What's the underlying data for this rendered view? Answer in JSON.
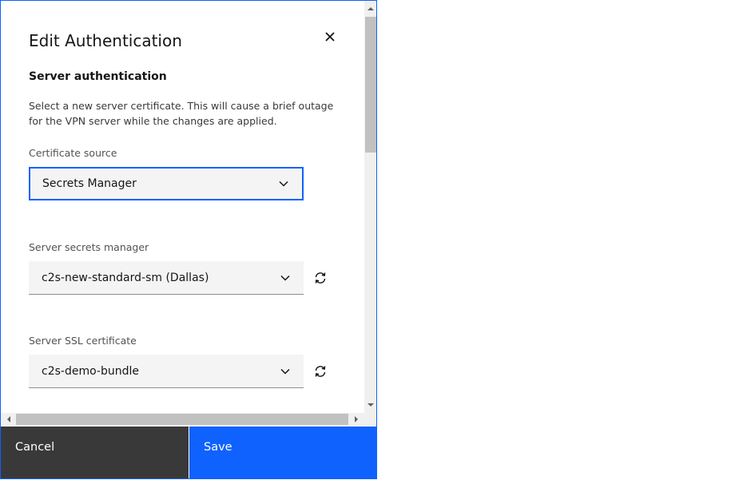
{
  "modal": {
    "title": "Edit Authentication",
    "close_icon": "close-icon",
    "section_heading": "Server authentication",
    "description": "Select a new server certificate. This will cause a brief outage for the VPN server while the changes are applied."
  },
  "fields": {
    "certificate_source": {
      "label": "Certificate source",
      "value": "Secrets Manager"
    },
    "secrets_manager": {
      "label": "Server secrets manager",
      "value": "c2s-new-standard-sm (Dallas)",
      "refresh_icon": "refresh-icon"
    },
    "ssl_certificate": {
      "label": "Server SSL certificate",
      "value": "c2s-demo-bundle",
      "refresh_icon": "refresh-icon"
    }
  },
  "footer": {
    "cancel_label": "Cancel",
    "save_label": "Save"
  },
  "colors": {
    "primary": "#0f62fe",
    "secondary": "#393939",
    "field_bg": "#f4f4f4"
  }
}
